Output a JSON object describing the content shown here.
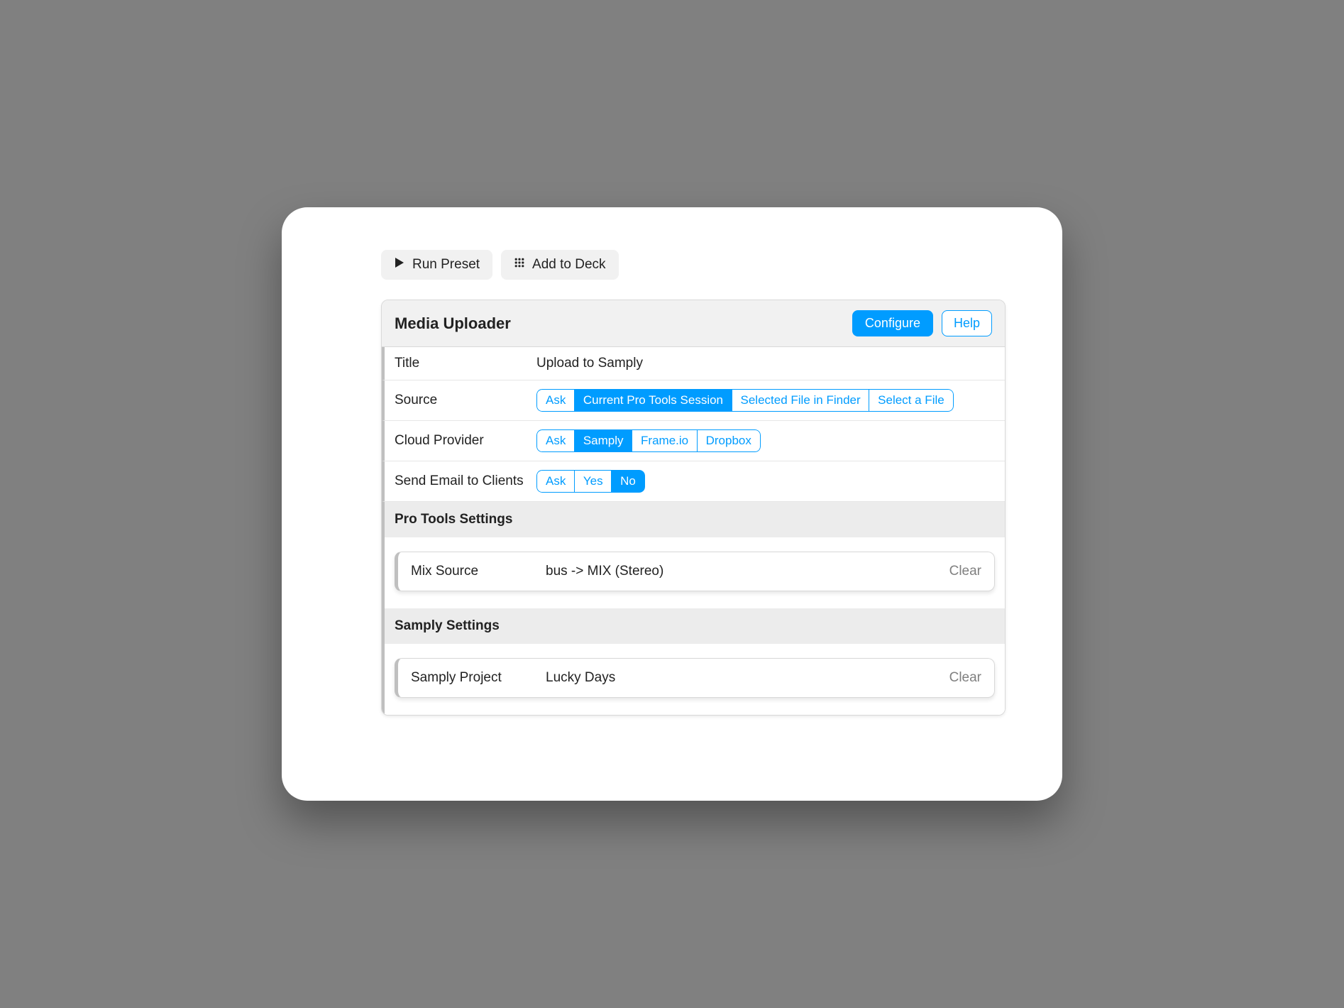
{
  "toolbar": {
    "run_preset": "Run Preset",
    "add_to_deck": "Add to Deck"
  },
  "panel": {
    "title": "Media Uploader",
    "configure": "Configure",
    "help": "Help"
  },
  "rows": {
    "title": {
      "label": "Title",
      "value": "Upload to Samply"
    },
    "source": {
      "label": "Source",
      "options": [
        "Ask",
        "Current Pro Tools Session",
        "Selected File in Finder",
        "Select a File"
      ],
      "selected": "Current Pro Tools Session"
    },
    "cloud_provider": {
      "label": "Cloud Provider",
      "options": [
        "Ask",
        "Samply",
        "Frame.io",
        "Dropbox"
      ],
      "selected": "Samply"
    },
    "send_email": {
      "label": "Send Email to Clients",
      "options": [
        "Ask",
        "Yes",
        "No"
      ],
      "selected": "No"
    }
  },
  "pro_tools": {
    "section_title": "Pro Tools Settings",
    "mix_source": {
      "label": "Mix Source",
      "value": "bus -> MIX (Stereo)",
      "clear": "Clear"
    }
  },
  "samply": {
    "section_title": "Samply Settings",
    "project": {
      "label": "Samply Project",
      "value": "Lucky Days",
      "clear": "Clear"
    }
  }
}
